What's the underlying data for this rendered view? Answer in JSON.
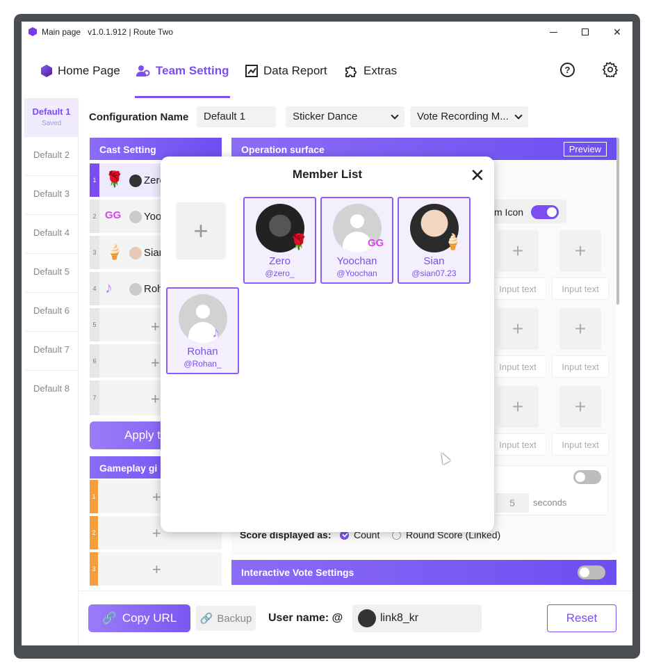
{
  "window": {
    "title": "Main page",
    "version": "v1.0.1.912 | Route Two"
  },
  "nav": {
    "home": "Home Page",
    "team": "Team Setting",
    "data": "Data Report",
    "extras": "Extras"
  },
  "sidebar": {
    "items": [
      {
        "label": "Default 1",
        "status": "Saved"
      },
      {
        "label": "Default 2"
      },
      {
        "label": "Default 3"
      },
      {
        "label": "Default 4"
      },
      {
        "label": "Default 5"
      },
      {
        "label": "Default 6"
      },
      {
        "label": "Default 7"
      },
      {
        "label": "Default 8"
      }
    ]
  },
  "config": {
    "label": "Configuration Name",
    "name": "Default 1",
    "mode": "Sticker Dance",
    "recording": "Vote Recording M..."
  },
  "cast": {
    "title": "Cast Setting",
    "rows": [
      {
        "num": "1",
        "gift": "🌹",
        "name": "Zero"
      },
      {
        "num": "2",
        "gift": "GG",
        "name": "Yoochan"
      },
      {
        "num": "3",
        "gift": "🍦",
        "name": "Sian"
      },
      {
        "num": "4",
        "gift": "♪",
        "name": "Rohan"
      },
      {
        "num": "5"
      },
      {
        "num": "6"
      },
      {
        "num": "7"
      }
    ]
  },
  "apply_label": "Apply t",
  "gameplay": {
    "title": "Gameplay gi",
    "rows": [
      "1",
      "2",
      "3"
    ]
  },
  "operation": {
    "title": "Operation surface",
    "preview": "Preview",
    "icon_toggle_label": "m Icon",
    "icon_toggle_on": true,
    "input_placeholder": "Input text",
    "timer_value": "5",
    "seconds_label": "seconds",
    "score_label": "Score displayed as:",
    "score_options": [
      "Count",
      "Round Score (Linked)"
    ],
    "score_selected": "Count"
  },
  "interactive_vote": {
    "title": "Interactive Vote Settings",
    "enabled": false
  },
  "bottom": {
    "copy_url": "Copy URL",
    "backup": "Backup",
    "user_label": "User name: @",
    "username": "link8_kr",
    "reset": "Reset"
  },
  "modal": {
    "title": "Member List",
    "members": [
      {
        "name": "Zero",
        "handle": "@zero_",
        "badge": "🌹"
      },
      {
        "name": "Yoochan",
        "handle": "@Yoochan",
        "badge": "GG"
      },
      {
        "name": "Sian",
        "handle": "@sian07.23",
        "badge": "🍦"
      },
      {
        "name": "Rohan",
        "handle": "@Rohan_",
        "badge": "♪"
      }
    ]
  },
  "colors": {
    "accent": "#7c4df0",
    "gameplay_number": "#f59e3b"
  }
}
